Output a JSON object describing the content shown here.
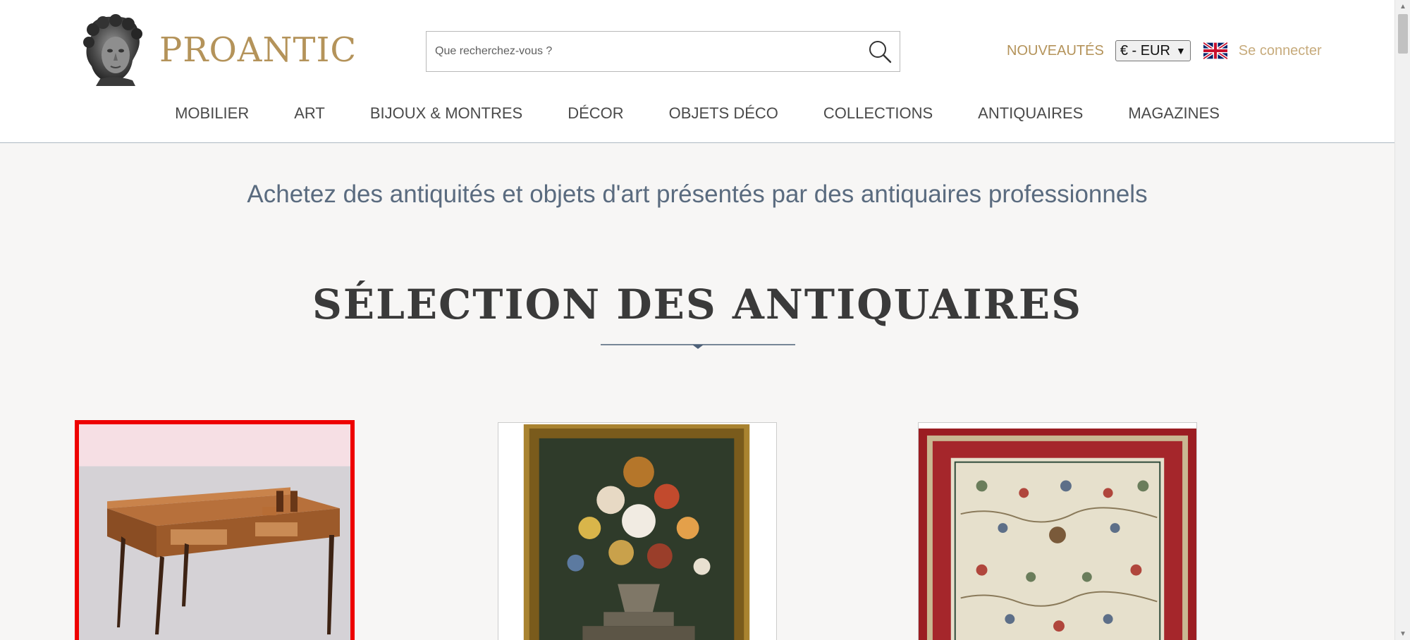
{
  "brand": {
    "name": "PROANTIC",
    "logo_icon": "bust-icon",
    "gold": "#b4935a",
    "tagline_color": "#5a6b7f"
  },
  "search": {
    "placeholder": "Que recherchez-vous ?",
    "icon": "search-icon"
  },
  "topbar": {
    "news_label": "NOUVEAUTÉS",
    "currency_selected": "€ - EUR",
    "language_flag": "uk-flag-icon",
    "login_label": "Se connecter"
  },
  "nav": {
    "items": [
      {
        "label": "MOBILIER"
      },
      {
        "label": "ART"
      },
      {
        "label": "BIJOUX & MONTRES"
      },
      {
        "label": "DÉCOR"
      },
      {
        "label": "OBJETS DÉCO"
      },
      {
        "label": "COLLECTIONS"
      },
      {
        "label": "ANTIQUAIRES"
      },
      {
        "label": "MAGAZINES"
      }
    ]
  },
  "main": {
    "tagline": "Achetez des antiquités et objets d'art présentés par des antiquaires professionnels",
    "section_title": "SÉLECTION DES ANTIQUAIRES",
    "selected_outline_color": "#ee0000",
    "products": [
      {
        "image": "writing-desk-image"
      },
      {
        "image": "floral-painting-image"
      },
      {
        "image": "persian-rug-image"
      }
    ]
  }
}
